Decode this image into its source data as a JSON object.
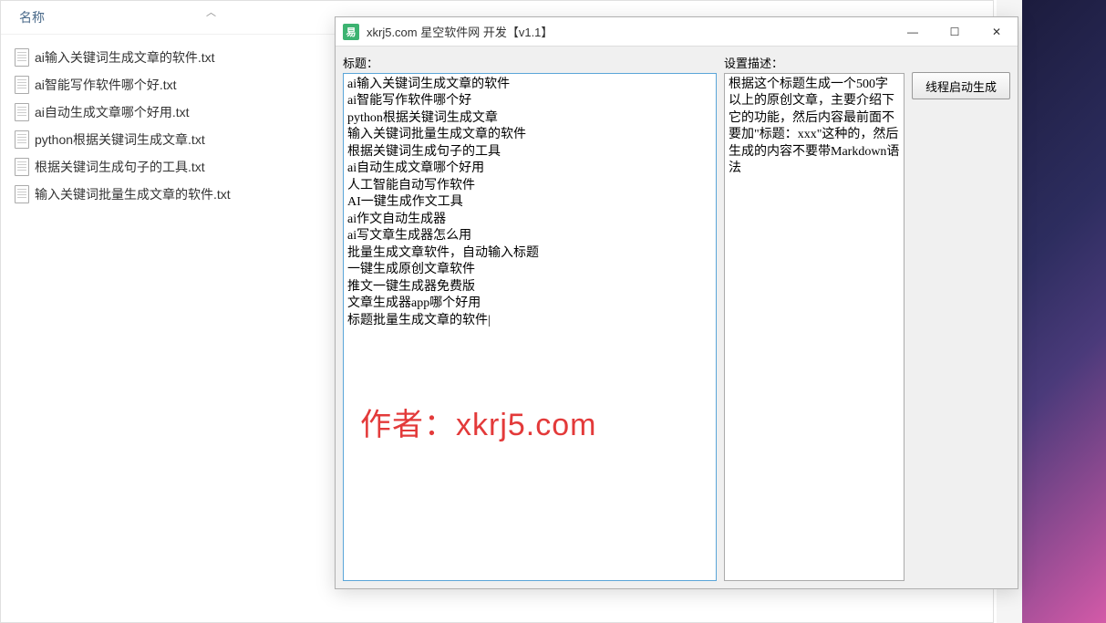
{
  "explorer": {
    "header": "名称",
    "files": [
      "ai输入关键词生成文章的软件.txt",
      "ai智能写作软件哪个好.txt",
      "ai自动生成文章哪个好用.txt",
      "python根据关键词生成文章.txt",
      "根据关键词生成句子的工具.txt",
      "输入关键词批量生成文章的软件.txt"
    ]
  },
  "app": {
    "icon_text": "易",
    "title": "xkrj5.com 星空软件网 开发【v1.1】",
    "labels": {
      "title_field": "标题：",
      "desc_field": "设置描述：",
      "generate": "线程启动生成"
    },
    "title_content": "ai输入关键词生成文章的软件\nai智能写作软件哪个好\npython根据关键词生成文章\n输入关键词批量生成文章的软件\n根据关键词生成句子的工具\nai自动生成文章哪个好用\n人工智能自动写作软件\nAI一键生成作文工具\nai作文自动生成器\nai写文章生成器怎么用\n批量生成文章软件，自动输入标题\n一键生成原创文章软件\n推文一键生成器免费版\n文章生成器app哪个好用\n标题批量生成文章的软件|",
    "desc_content": "根据这个标题生成一个500字以上的原创文章，主要介绍下它的功能，然后内容最前面不要加\"标题：xxx\"这种的，然后生成的内容不要带Markdown语法"
  },
  "watermark": "作者：xkrj5.com",
  "window_controls": {
    "minimize": "—",
    "maximize": "☐",
    "close": "✕"
  }
}
